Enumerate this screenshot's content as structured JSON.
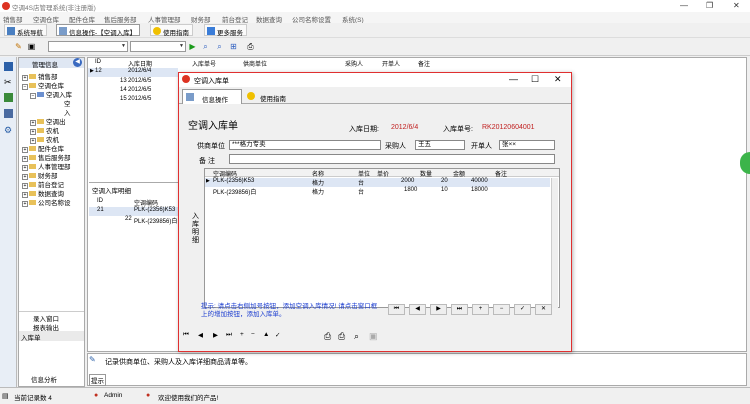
{
  "window": {
    "title": "空调4S店管理系统(非注册版)"
  },
  "menu": [
    "销售部",
    "空调仓库",
    "配件仓库",
    "售后服务部",
    "人事管理部",
    "财务部",
    "前台登记",
    "数据查询",
    "公司名称设置",
    "系统(S)"
  ],
  "toolbar1": {
    "btn1": "系统导航",
    "btn2": "信息操作-【空调入库】",
    "btn3": "使用指南",
    "btn4": "更多服务"
  },
  "left": {
    "header": "管理信息",
    "tree": [
      "销售部",
      "空调仓库",
      "空调入库",
      "空",
      "入",
      "空调出",
      "农机",
      "农机",
      "配件仓库",
      "售后服务部",
      "人事管理部",
      "财务部",
      "前台登记",
      "数据查询",
      "公司名称设"
    ],
    "bottom_items": [
      "录入窗口",
      "报表输出",
      "入库单"
    ],
    "analysis": "信息分析"
  },
  "main_grid": {
    "headers": [
      "ID",
      "入库日期",
      "入库单号",
      "供商单位",
      "采购人",
      "开单人",
      "备注"
    ],
    "rows": [
      [
        "12",
        "2012/6/4",
        "",
        "",
        "",
        "",
        ""
      ],
      [
        "13",
        "2012/6/5",
        "",
        "",
        "",
        "",
        ""
      ],
      [
        "14",
        "2012/6/5",
        "",
        "",
        "",
        "",
        ""
      ],
      [
        "15",
        "2012/6/5",
        "",
        "",
        "",
        "",
        ""
      ]
    ]
  },
  "detail_grid": {
    "title": "空调入库明细",
    "headers": [
      "ID",
      "空调编码"
    ],
    "rows": [
      [
        "21",
        "PLK-(2356)K53"
      ],
      [
        "22",
        "PLK-(239856)白"
      ]
    ]
  },
  "dialog": {
    "title": "空调入库单",
    "tab1": "信息操作",
    "tab2": "使用指南",
    "form_title": "空调入库单",
    "date_label": "入库日期:",
    "date_value": "2012/6/4",
    "no_label": "入库单号:",
    "no_value": "RK20120604001",
    "supplier_label": "供商单位",
    "supplier_value": "***格力专卖",
    "buyer_label": "采购人",
    "buyer_value": "王五",
    "creator_label": "开单人",
    "creator_value": "张××",
    "remark_label": "备  注",
    "side_label": "入库明细",
    "grid_headers": [
      "空调编码",
      "名称",
      "单位",
      "单价",
      "数量",
      "金额",
      "备注"
    ],
    "grid_rows": [
      [
        "PLK-(2356)K53",
        "格力",
        "台",
        "2000",
        "20",
        "40000",
        ""
      ],
      [
        "PLK-(239856)白",
        "格力",
        "台",
        "1800",
        "10",
        "18000",
        ""
      ]
    ],
    "hint": "提示: 请点击右侧加号按钮，添加空调入库情况! 请点击窗口框上的增加按钮，添加入库单。"
  },
  "info_bar": {
    "text": "记录供商单位、采购人及入库详细商品清单等。",
    "hint": "提示"
  },
  "status": {
    "record": "当前记录数 4",
    "user": "Admin",
    "welcome": "欢迎使用我们的产品!"
  }
}
